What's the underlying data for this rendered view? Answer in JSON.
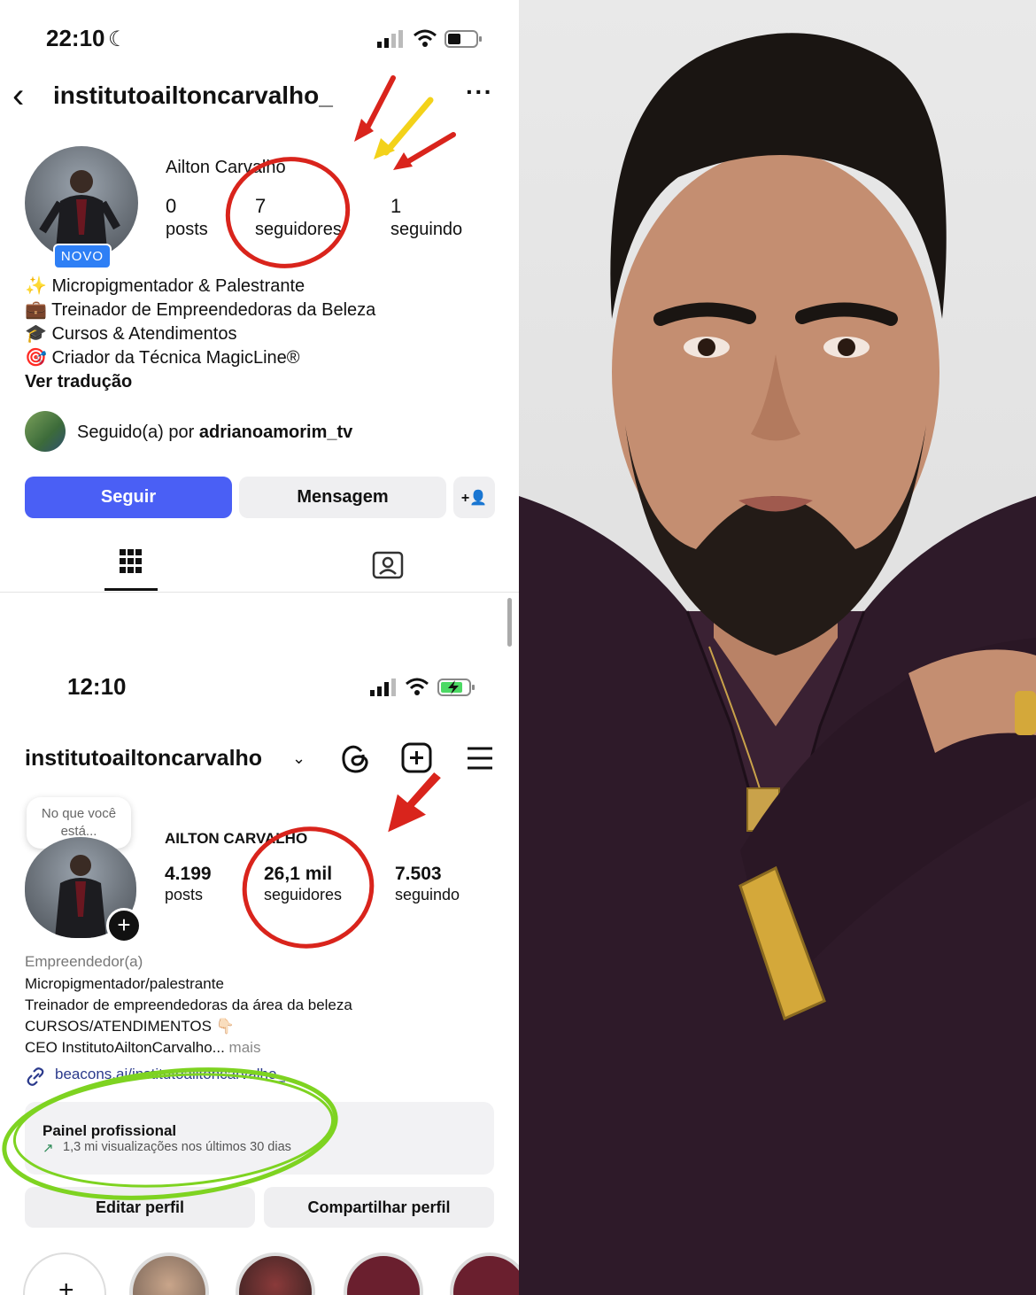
{
  "top_screen": {
    "status": {
      "time": "22:10"
    },
    "header": {
      "username": "institutoailtoncarvalho_"
    },
    "profile": {
      "display_name": "Ailton Carvalho",
      "badge": "NOVO",
      "stats": [
        {
          "value": "0",
          "label": "posts"
        },
        {
          "value": "7",
          "label": "seguidores"
        },
        {
          "value": "1",
          "label": "seguindo"
        }
      ]
    },
    "bio": [
      {
        "emoji": "✨",
        "text": "Micropigmentador & Palestrante"
      },
      {
        "emoji": "💼",
        "text": "Treinador de Empreendedoras da Beleza"
      },
      {
        "emoji": "🎓",
        "text": "Cursos & Atendimentos"
      },
      {
        "emoji": "🎯",
        "text": "Criador da Técnica MagicLine®"
      }
    ],
    "translate_link": "Ver tradução",
    "followed_by": {
      "prefix": "Seguido(a) por ",
      "user": "adrianoamorim_tv"
    },
    "buttons": {
      "follow": "Seguir",
      "message": "Mensagem",
      "add_user": "+👤"
    }
  },
  "bottom_screen": {
    "status": {
      "time": "12:10"
    },
    "header": {
      "username": "institutoailtoncarvalho"
    },
    "note_bubble": "No que você está...",
    "profile": {
      "display_name": "AILTON CARVALHO",
      "stats": [
        {
          "value": "4.199",
          "label": "posts"
        },
        {
          "value": "26,1 mil",
          "label": "seguidores"
        },
        {
          "value": "7.503",
          "label": "seguindo"
        }
      ]
    },
    "category": "Empreendedor(a)",
    "bio": [
      "Micropigmentador/palestrante",
      "Treinador de empreendedoras da área da beleza",
      "CURSOS/ATENDIMENTOS 👇🏻",
      "CEO InstitutoAiltonCarvalho..."
    ],
    "more": " mais",
    "link": "beacons.ai/institutoailtoncarvalho_",
    "dashboard": {
      "title": "Painel profissional",
      "subtitle": "1,3 mi visualizações nos últimos 30 dias"
    },
    "buttons": {
      "edit": "Editar perfil",
      "share": "Compartilhar perfil"
    }
  },
  "colors": {
    "follow_blue": "#4a5ff5",
    "annotation_red": "#d9241c",
    "annotation_yellow": "#f3d21a",
    "annotation_green": "#7ed321",
    "link_blue": "#2b3a8c"
  }
}
